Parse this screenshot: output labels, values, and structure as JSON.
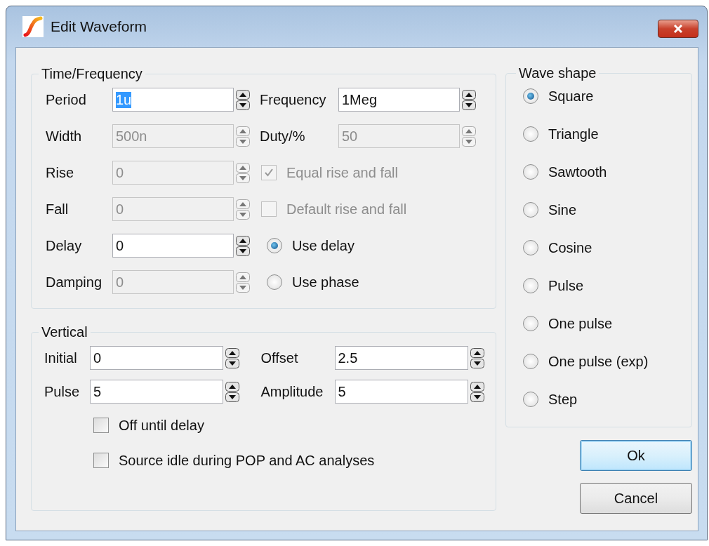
{
  "window": {
    "title": "Edit Waveform"
  },
  "time_frequency": {
    "title": "Time/Frequency",
    "fields": [
      {
        "label": "Period",
        "value": "1u",
        "disabled": false,
        "text_selected": true
      },
      {
        "label": "Width",
        "value": "500n",
        "disabled": true,
        "text_selected": false
      },
      {
        "label": "Rise",
        "value": "0",
        "disabled": true,
        "text_selected": false
      },
      {
        "label": "Fall",
        "value": "0",
        "disabled": true,
        "text_selected": false
      },
      {
        "label": "Delay",
        "value": "0",
        "disabled": false,
        "text_selected": false
      },
      {
        "label": "Damping",
        "value": "0",
        "disabled": true,
        "text_selected": false
      }
    ],
    "options": [
      {
        "kind": "field",
        "label": "Frequency",
        "value": "1Meg",
        "disabled": false
      },
      {
        "kind": "field",
        "label": "Duty/%",
        "value": "50",
        "disabled": true
      },
      {
        "kind": "checkbox",
        "label": "Equal rise and fall",
        "checked": true,
        "disabled": true
      },
      {
        "kind": "checkbox",
        "label": "Default rise and fall",
        "checked": false,
        "disabled": true
      },
      {
        "kind": "radio",
        "label": "Use delay",
        "selected": true
      },
      {
        "kind": "radio",
        "label": "Use phase",
        "selected": false
      }
    ]
  },
  "vertical": {
    "title": "Vertical",
    "fields": [
      {
        "label": "Initial",
        "value": "0"
      },
      {
        "label": "Offset",
        "value": "2.5"
      },
      {
        "label": "Pulse",
        "value": "5"
      },
      {
        "label": "Amplitude",
        "value": "5"
      }
    ],
    "checkboxes": [
      {
        "label": "Off until delay",
        "checked": false
      },
      {
        "label": "Source idle during POP and AC analyses",
        "checked": false
      }
    ]
  },
  "wave_shape": {
    "title": "Wave shape",
    "options": [
      {
        "label": "Square",
        "selected": true
      },
      {
        "label": "Triangle",
        "selected": false
      },
      {
        "label": "Sawtooth",
        "selected": false
      },
      {
        "label": "Sine",
        "selected": false
      },
      {
        "label": "Cosine",
        "selected": false
      },
      {
        "label": "Pulse",
        "selected": false
      },
      {
        "label": "One pulse",
        "selected": false
      },
      {
        "label": "One pulse (exp)",
        "selected": false
      },
      {
        "label": "Step",
        "selected": false
      }
    ]
  },
  "buttons": [
    {
      "label": "Ok",
      "default": true
    },
    {
      "label": "Cancel",
      "default": false
    }
  ]
}
